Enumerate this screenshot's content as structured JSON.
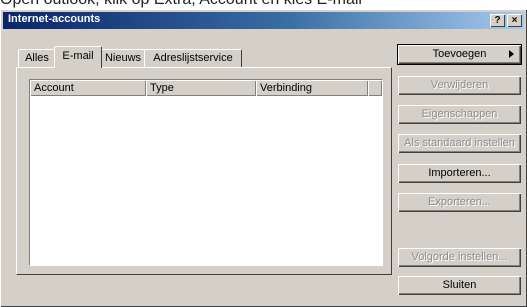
{
  "caption": "Open outlook, klik op Extra, Account en kies E-mail",
  "window": {
    "title": "Internet-accounts",
    "help_label": "?",
    "close_label": "×"
  },
  "tabs": [
    {
      "label": "Alles",
      "active": false
    },
    {
      "label": "E-mail",
      "active": true
    },
    {
      "label": "Nieuws",
      "active": false
    },
    {
      "label": "Adreslijstservice",
      "active": false
    }
  ],
  "list": {
    "columns": [
      "Account",
      "Type",
      "Verbinding"
    ],
    "rows": []
  },
  "buttons": {
    "add": {
      "label": "Toevoegen",
      "enabled": true
    },
    "remove": {
      "label": "Verwijderen",
      "enabled": false
    },
    "properties": {
      "label": "Eigenschappen",
      "enabled": false
    },
    "set_default": {
      "label": "Als standaard instellen",
      "enabled": false
    },
    "import": {
      "label": "Importeren...",
      "enabled": true
    },
    "export": {
      "label": "Exporteren...",
      "enabled": false
    },
    "set_order": {
      "label": "Volgorde instellen...",
      "enabled": false
    },
    "close": {
      "label": "Sluiten",
      "enabled": true
    }
  }
}
